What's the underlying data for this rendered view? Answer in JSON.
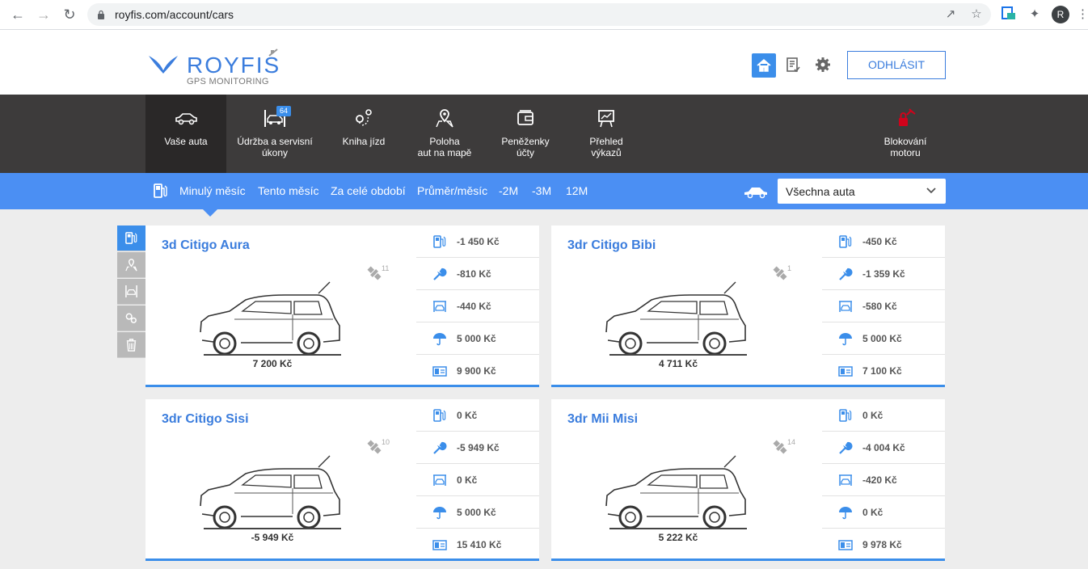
{
  "browser": {
    "url": "royfis.com/account/cars",
    "avatar_letter": "R"
  },
  "header": {
    "logo_text": "ROYFIS",
    "logo_sub": "GPS MONITORING",
    "logout_label": "ODHLÁSIT"
  },
  "main_nav": {
    "items": [
      {
        "label": "Vaše auta",
        "icon": "car-icon"
      },
      {
        "label": "Údržba a servisní\núkony",
        "icon": "service-lift-icon",
        "badge": "64"
      },
      {
        "label": "Kniha jízd",
        "icon": "route-icon"
      },
      {
        "label": "Poloha\naut na mapě",
        "icon": "map-pin-icon"
      },
      {
        "label": "Peněženky\núčty",
        "icon": "wallet-icon"
      },
      {
        "label": "Přehled\nvýkazů",
        "icon": "report-board-icon"
      },
      {
        "label": "Blokování\nmotoru",
        "icon": "engine-lock-icon"
      }
    ]
  },
  "filter_bar": {
    "links": [
      "Minulý měsíc",
      "Tento měsíc",
      "Za celé období",
      "Průměr/měsíc",
      "-2M",
      "-3M",
      "12M"
    ],
    "car_select_value": "Všechna auta"
  },
  "cars": [
    {
      "name": "3d Citigo Aura",
      "satellites": "11",
      "total": "7 200 Kč",
      "stats": [
        "-1 450 Kč",
        "-810 Kč",
        "-440 Kč",
        "5 000 Kč",
        "9 900 Kč"
      ]
    },
    {
      "name": "3dr Citigo Bibi",
      "satellites": "1",
      "total": "4 711 Kč",
      "stats": [
        "-450 Kč",
        "-1 359 Kč",
        "-580 Kč",
        "5 000 Kč",
        "7 100 Kč"
      ]
    },
    {
      "name": "3dr Citigo Sisi",
      "satellites": "10",
      "total": "-5 949 Kč",
      "stats": [
        "0 Kč",
        "-5 949 Kč",
        "0 Kč",
        "5 000 Kč",
        "15 410 Kč"
      ]
    },
    {
      "name": "3dr Mii Misi",
      "satellites": "14",
      "total": "5 222 Kč",
      "stats": [
        "0 Kč",
        "-4 004 Kč",
        "-420 Kč",
        "0 Kč",
        "9 978 Kč"
      ]
    }
  ],
  "stat_icons": [
    "fuel-pump-icon",
    "wrench-icon",
    "service-lift-icon",
    "umbrella-icon",
    "money-icon"
  ],
  "colors": {
    "brand_blue": "#3b7ddd",
    "filter_bar": "#4b8ff3",
    "nav_dark": "#3d3b3b",
    "alert_red": "#d0021b"
  }
}
